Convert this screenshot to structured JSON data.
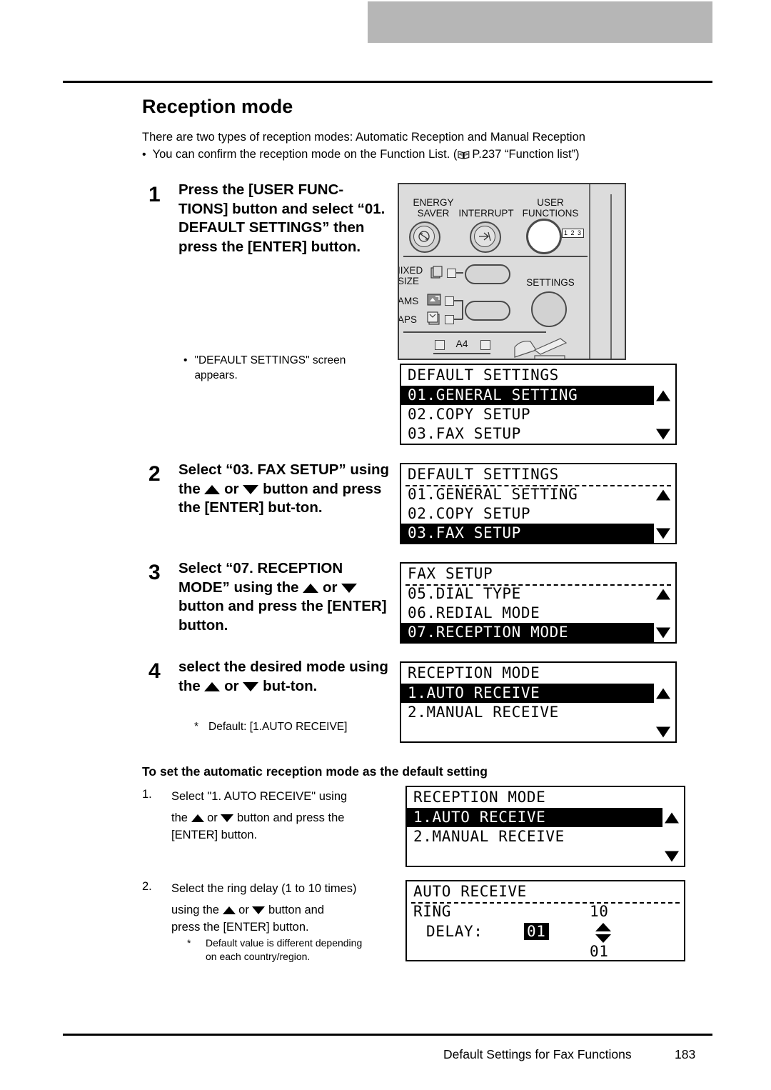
{
  "document": {
    "title": "Reception mode",
    "intro": "There are two types of reception modes: Automatic Reception and Manual Reception",
    "bullet_prefix": "You can confirm the reception mode on the Function List. (",
    "bullet_ref": "P.237 “Function list”)",
    "book_icon": "book-icon"
  },
  "footer": {
    "title": "Default Settings for Fax Functions",
    "page": "183"
  },
  "steps": [
    {
      "num": "1",
      "text": "Press the [USER FUNC-TIONS] button and select “01. DEFAULT SETTINGS” then press the [ENTER] button.",
      "note_bullet": "•",
      "note": "\"DEFAULT SETTINGS\" screen appears."
    },
    {
      "num": "2",
      "text_a": "Select “03. FAX SETUP” using the",
      "text_b": "or",
      "text_c": "button and press the [ENTER] but-ton."
    },
    {
      "num": "3",
      "text_a": "Select “07. RECEPTION MODE” using the",
      "text_b": "or",
      "text_c": "button and press the [ENTER] button."
    },
    {
      "num": "4",
      "text_a": "select the desired mode using the",
      "text_b": "or",
      "text_c": "but-ton.",
      "note_star": "*",
      "note": "Default: [1.AUTO RECEIVE]"
    }
  ],
  "subsection": {
    "heading": "To set the automatic reception mode as the default setting",
    "items": [
      {
        "num": "1.",
        "line1": "Select \"1. AUTO RECEIVE\" using",
        "line2_a": "the",
        "line2_b": "or",
        "line2_c": "button and press the",
        "line3": "[ENTER] button."
      },
      {
        "num": "2.",
        "line1": "Select the ring delay (1 to 10 times)",
        "line2_a": "using the",
        "line2_b": "or",
        "line2_c": "button and",
        "line3": "press the [ENTER] button.",
        "note_star": "*",
        "note_line1": "Default value is different depending",
        "note_line2": "on each country/region."
      }
    ]
  },
  "control_panel": {
    "labels": {
      "energy_saver_1": "ENERGY",
      "energy_saver_2": "SAVER",
      "interrupt": "INTERRUPT",
      "user_1": "USER",
      "user_2": "FUNCTIONS",
      "settings": "SETTINGS",
      "mixed_1": "IIXED",
      "mixed_2": "SIZE",
      "ams": "AMS",
      "aps": "APS",
      "a4": "A4",
      "keypad": "1 2 3"
    }
  },
  "screens": [
    {
      "id": "screen-default-settings-1",
      "title": "DEFAULT SETTINGS",
      "rows": [
        {
          "label": "01.GENERAL SETTING",
          "selected": true,
          "arrow": "up"
        },
        {
          "label": "02.COPY SETUP",
          "selected": false,
          "arrow": ""
        },
        {
          "label": "03.FAX SETUP",
          "selected": false,
          "arrow": "down"
        }
      ]
    },
    {
      "id": "screen-default-settings-2",
      "title": "DEFAULT SETTINGS",
      "rows": [
        {
          "label": "01.GENERAL SETTING",
          "selected": false,
          "arrow": "up"
        },
        {
          "label": "02.COPY SETUP",
          "selected": false,
          "arrow": ""
        },
        {
          "label": "03.FAX SETUP",
          "selected": true,
          "arrow": "down"
        }
      ]
    },
    {
      "id": "screen-fax-setup",
      "title": "FAX SETUP",
      "rows": [
        {
          "label": "05.DIAL TYPE",
          "selected": false,
          "arrow": "up"
        },
        {
          "label": "06.REDIAL MODE",
          "selected": false,
          "arrow": ""
        },
        {
          "label": "07.RECEPTION MODE",
          "selected": true,
          "arrow": "down"
        }
      ]
    },
    {
      "id": "screen-reception-mode-1",
      "title": "RECEPTION MODE",
      "rows": [
        {
          "label": "1.AUTO RECEIVE",
          "selected": true,
          "arrow": "up"
        },
        {
          "label": "2.MANUAL RECEIVE",
          "selected": false,
          "arrow": ""
        },
        {
          "label": "",
          "selected": false,
          "arrow": "down"
        }
      ]
    },
    {
      "id": "screen-reception-mode-2",
      "title": "RECEPTION MODE",
      "rows": [
        {
          "label": "1.AUTO RECEIVE",
          "selected": true,
          "arrow": "up"
        },
        {
          "label": "2.MANUAL RECEIVE",
          "selected": false,
          "arrow": ""
        },
        {
          "label": "",
          "selected": false,
          "arrow": "down"
        }
      ]
    }
  ],
  "auto_receive_screen": {
    "id": "screen-auto-receive",
    "title": "AUTO RECEIVE",
    "ring_label": "RING",
    "delay_label": "DELAY:",
    "delay_value": "01",
    "max_value": "10",
    "min_value": "01"
  }
}
